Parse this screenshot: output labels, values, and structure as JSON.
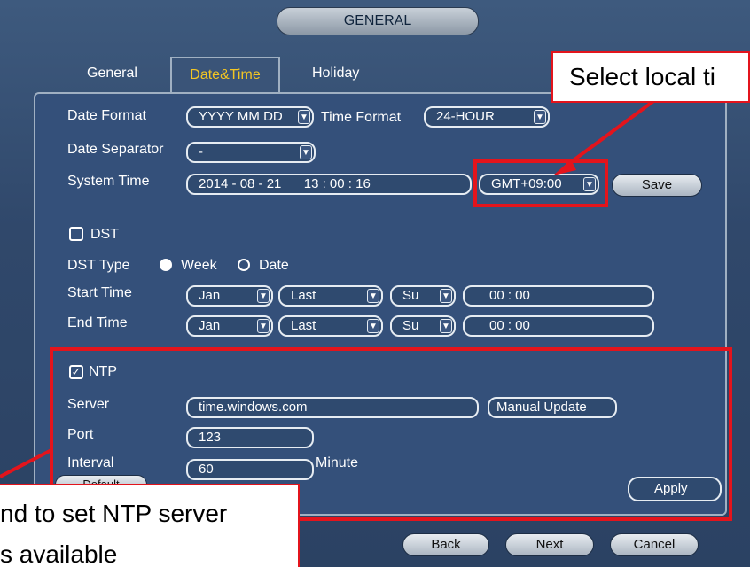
{
  "window": {
    "title": "GENERAL"
  },
  "tabs": [
    {
      "label": "General"
    },
    {
      "label": "Date&Time"
    },
    {
      "label": "Holiday"
    }
  ],
  "form": {
    "date_format_label": "Date Format",
    "date_format_value": "YYYY MM DD",
    "time_format_label": "Time Format",
    "time_format_value": "24-HOUR",
    "date_separator_label": "Date Separator",
    "date_separator_value": "-",
    "system_time_label": "System Time",
    "system_time_date": "2014 - 08 - 21",
    "system_time_time": "13 : 00 : 16",
    "timezone_value": "GMT+09:00",
    "save_label": "Save",
    "dst_label": "DST",
    "dst_checked": false,
    "dst_type_label": "DST Type",
    "dst_type_week": "Week",
    "dst_type_date": "Date",
    "dst_type_selected": "Week",
    "start_time_label": "Start Time",
    "end_time_label": "End Time",
    "start": {
      "month": "Jan",
      "week": "Last",
      "day": "Su",
      "time": "00 :  00"
    },
    "end": {
      "month": "Jan",
      "week": "Last",
      "day": "Su",
      "time": "00 :  00"
    },
    "ntp_label": "NTP",
    "ntp_checked": true,
    "server_label": "Server",
    "server_value": "time.windows.com",
    "manual_update_label": "Manual Update",
    "port_label": "Port",
    "port_value": "123",
    "interval_label": "Interval",
    "interval_value": "60",
    "interval_unit": "Minute",
    "default_label": "Default",
    "apply_label": "Apply"
  },
  "footer": {
    "back_label": "Back",
    "next_label": "Next",
    "cancel_label": "Cancel"
  },
  "annotations": {
    "timezone_callout": "Select local ti",
    "ntp_callout_line1": "nd to set NTP server",
    "ntp_callout_line2": "s available"
  },
  "colors": {
    "highlight": "#e3141c",
    "active_tab_text": "#f3c623",
    "background": "#30486b"
  }
}
